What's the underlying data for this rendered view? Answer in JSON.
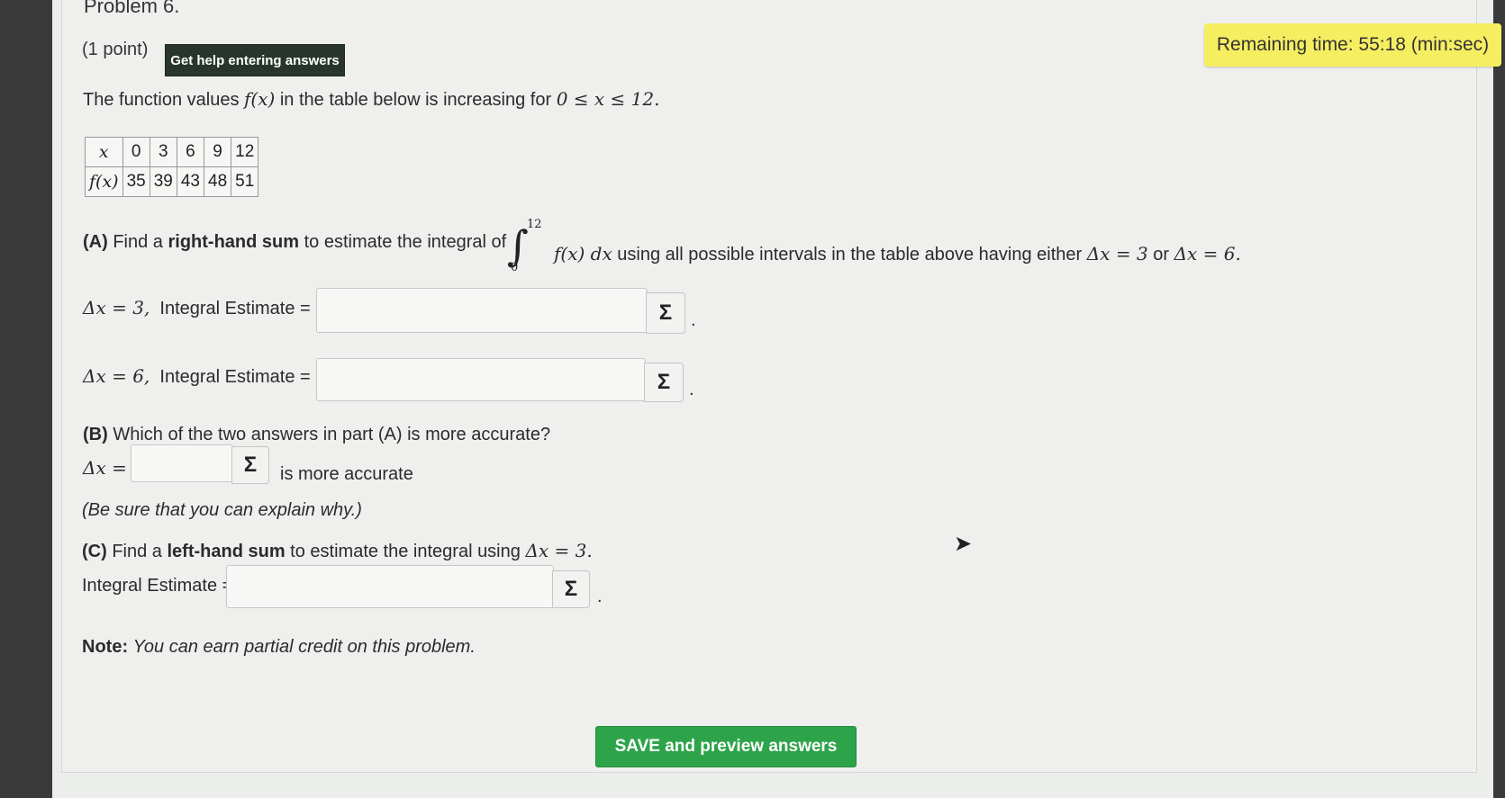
{
  "problem": {
    "title": "Problem 6.",
    "points": "(1 point)",
    "help_button": "Get help entering answers",
    "timer": "Remaining time: 55:18 (min:sec)"
  },
  "intro": {
    "pre": "The function values",
    "fx": "f(x)",
    "mid": "in the table below is increasing for",
    "range": "0 ≤ x ≤ 12."
  },
  "table": {
    "row1_label": "x",
    "row2_label": "f(x)",
    "x_values": [
      "0",
      "3",
      "6",
      "9",
      "12"
    ],
    "f_values": [
      "35",
      "39",
      "43",
      "48",
      "51"
    ]
  },
  "partA": {
    "label": "(A)",
    "text1": "Find a",
    "bold": "right-hand sum",
    "text2": "to estimate the integral of",
    "upper": "12",
    "lower": "0",
    "integrand": "f(x) dx",
    "text3": "using all possible intervals in the table above having either",
    "dx1": "Δx = 3",
    "or": "or",
    "dx2": "Δx = 6.",
    "row1_math": "Δx = 3,",
    "row2_math": "Δx = 6,",
    "estimate_label": "Integral Estimate ="
  },
  "partB": {
    "label": "(B)",
    "text": "Which of the two answers in part (A) is more accurate?",
    "dx": "Δx =",
    "suffix": "is more accurate",
    "note": "(Be sure that you can explain why.)"
  },
  "partC": {
    "label": "(C)",
    "text1": "Find a",
    "bold": "left-hand sum",
    "text2": "to estimate the integral using",
    "dx": "Δx = 3.",
    "estimate_label": "Integral Estimate ="
  },
  "note": {
    "label": "Note:",
    "text": "You can earn partial credit on this problem."
  },
  "sigma": "Σ",
  "period": ".",
  "save_button": "SAVE and preview answers"
}
